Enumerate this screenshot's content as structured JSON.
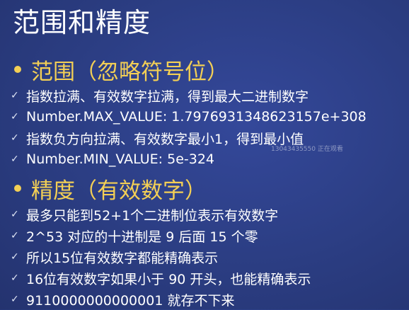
{
  "slide": {
    "title": "范围和精度",
    "sections": [
      {
        "heading": "范围（忽略符号位）",
        "items": [
          "指数拉满、有效数字拉满，得到最大二进制数字",
          "Number.MAX_VALUE: 1.7976931348623157e+308",
          "指数负方向拉满、有效数字最小1，得到最小值",
          "Number.MIN_VALUE: 5e-324"
        ]
      },
      {
        "heading": "精度（有效数字）",
        "items": [
          "最多只能到52+1个二进制位表示有效数字",
          "2^53 对应的十进制是 9 后面 15 个零",
          "所以15位有效数字都能精确表示",
          "16位有效数字如果小于 90 开头，也能精确表示",
          "9110000000000001 就存不下来"
        ]
      }
    ],
    "watermark": "13043435550 正在观看"
  },
  "icons": {
    "bullet": "dot-bullet-icon",
    "check": "checkmark-icon"
  },
  "colors": {
    "background": "#2b3d82",
    "heading": "#f3cf55",
    "text": "#ffffff"
  }
}
